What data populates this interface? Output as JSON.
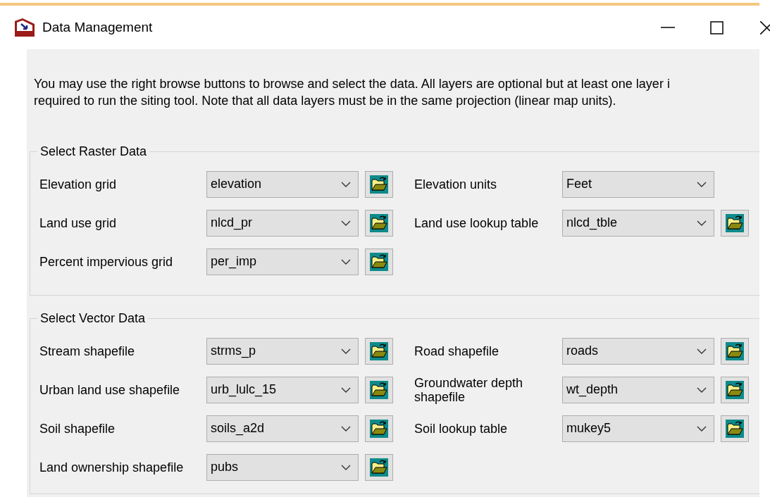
{
  "window": {
    "title": "Data Management"
  },
  "intro": "You may use the right browse buttons to browse and select the data. All layers are optional but at least one layer i\nrequired to run the siting tool. Note that all data layers must be in the same projection (linear map units).",
  "groups": [
    {
      "title": "Select Raster Data",
      "rows": [
        [
          {
            "label": "Elevation grid",
            "value": "elevation",
            "kind": "combo_browse"
          },
          {
            "label": "Elevation units",
            "value": "Feet",
            "kind": "combo"
          }
        ],
        [
          {
            "label": "Land use grid",
            "value": "nlcd_pr",
            "kind": "combo_browse"
          },
          {
            "label": "Land use lookup table",
            "value": "nlcd_tble",
            "kind": "combo_browse"
          }
        ],
        [
          {
            "label": "Percent impervious grid",
            "value": "per_imp",
            "kind": "combo_browse"
          }
        ]
      ]
    },
    {
      "title": "Select Vector Data",
      "rows": [
        [
          {
            "label": "Stream shapefile",
            "value": "strms_p",
            "kind": "combo_browse"
          },
          {
            "label": "Road shapefile",
            "value": "roads",
            "kind": "combo_browse"
          }
        ],
        [
          {
            "label": "Urban land use shapefile",
            "value": "urb_lulc_15",
            "kind": "combo_browse"
          },
          {
            "label": "Groundwater  depth shapefile",
            "value": "wt_depth",
            "kind": "combo_browse"
          }
        ],
        [
          {
            "label": "Soil shapefile",
            "value": "soils_a2d",
            "kind": "combo_browse"
          },
          {
            "label": "Soil lookup table",
            "value": "mukey5",
            "kind": "combo_browse"
          }
        ],
        [
          {
            "label": "Land ownership shapefile",
            "value": "pubs",
            "kind": "combo_browse"
          }
        ]
      ]
    }
  ]
}
